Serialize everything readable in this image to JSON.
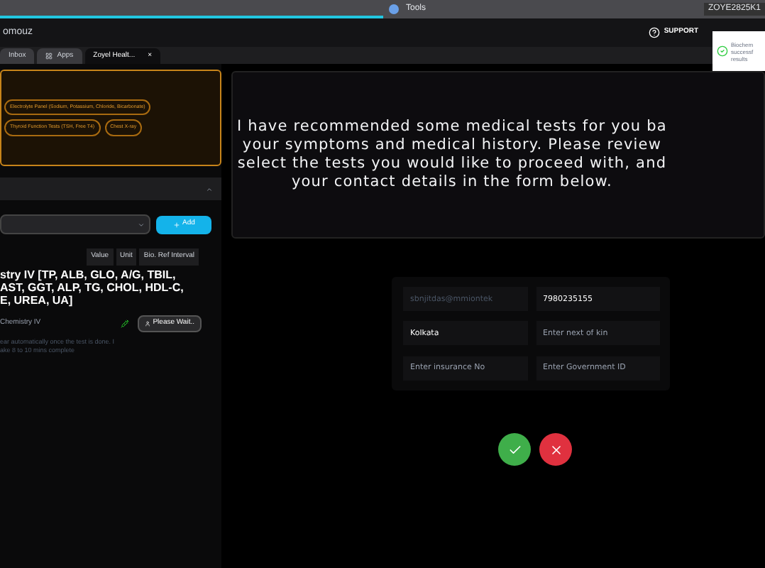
{
  "browser": {
    "tab_title": "Tools",
    "profile": "ZOYE2825K1"
  },
  "header": {
    "brand": "omouz",
    "support": "SUPPORT"
  },
  "toast": {
    "lines": [
      "Biochem",
      "successf",
      "results"
    ]
  },
  "tabs": [
    {
      "label": "Inbox",
      "selected": false
    },
    {
      "label": "Apps",
      "selected": false
    },
    {
      "label": "Zoyel Healt...",
      "selected": true,
      "close": "×"
    }
  ],
  "recommended_tests": [
    "Electrolyte Panel (Sodium, Potassium, Chloride, Bicarbonate)",
    "Thyroid Function Tests (TSH, Free T4)",
    "Chest X-ray"
  ],
  "add_button": "Add",
  "table": {
    "columns": [
      "Value",
      "Unit",
      "Bio. Ref Interval"
    ],
    "test_name": [
      "stry IV [TP, ALB, GLO, A/G, TBIL,",
      "AST, GGT, ALP, TG, CHOL, HDL-C,",
      "E, UREA, UA]"
    ],
    "test_label": "Chemistry IV",
    "status_button": "Please Wait..",
    "note": [
      "ear automatically once the test is done. I",
      "ake 8 to 10 mins complete"
    ]
  },
  "message": [
    "I have recommended some medical tests for you ba",
    "your symptoms and medical history. Please review",
    "select the tests you would like to proceed with, and",
    "your contact details in the form below."
  ],
  "form": [
    {
      "value": "sbnjitdas@mmiontek",
      "disabled": true
    },
    {
      "value": "7980235155",
      "disabled": false
    },
    {
      "value": "Kolkata",
      "disabled": false
    },
    {
      "placeholder": "Enter next of kin"
    },
    {
      "placeholder": "Enter insurance No"
    },
    {
      "placeholder": "Enter Government ID"
    }
  ]
}
